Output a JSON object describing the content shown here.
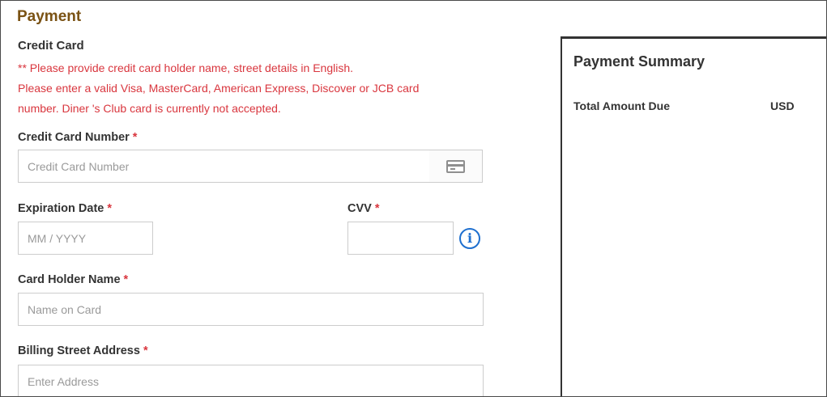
{
  "payment": {
    "section_title": "Payment",
    "subtitle": "Credit Card",
    "notice_lines": [
      "** Please provide credit card holder name, street details in English.",
      "Please enter a valid Visa, MasterCard, American Express, Discover or JCB card",
      "number. Diner 's Club card is currently not accepted."
    ],
    "required_mark": "*",
    "card_number": {
      "label": "Credit Card Number",
      "placeholder": "Credit Card Number",
      "value": ""
    },
    "expiration": {
      "label": "Expiration Date",
      "placeholder": "MM / YYYY",
      "value": ""
    },
    "cvv": {
      "label": "CVV",
      "placeholder": "",
      "value": ""
    },
    "holder_name": {
      "label": "Card Holder Name",
      "placeholder": "Name on Card",
      "value": ""
    },
    "billing_address": {
      "label": "Billing Street Address",
      "placeholder": "Enter Address",
      "value": ""
    },
    "icons": {
      "card": "credit-card-icon",
      "cvv_info": "info-icon"
    },
    "colors": {
      "title": "#7a5214",
      "notice": "#d9363e",
      "info": "#1e6fcf"
    }
  },
  "summary": {
    "title": "Payment Summary",
    "total_label": "Total Amount Due",
    "currency": "USD"
  }
}
